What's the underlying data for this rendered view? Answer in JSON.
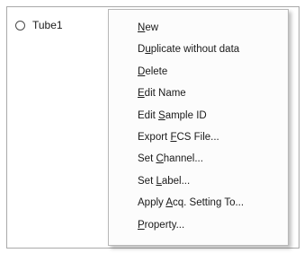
{
  "tree": {
    "item_label": "Tube1",
    "item_icon": "radio-circle-icon"
  },
  "context_menu": {
    "items": [
      {
        "pre": "",
        "mn": "N",
        "post": "ew"
      },
      {
        "pre": "D",
        "mn": "u",
        "post": "plicate without data"
      },
      {
        "pre": "",
        "mn": "D",
        "post": "elete"
      },
      {
        "pre": "",
        "mn": "E",
        "post": "dit Name"
      },
      {
        "pre": "Edit ",
        "mn": "S",
        "post": "ample ID"
      },
      {
        "pre": "Export ",
        "mn": "F",
        "post": "CS File..."
      },
      {
        "pre": "Set ",
        "mn": "C",
        "post": "hannel..."
      },
      {
        "pre": "Set ",
        "mn": "L",
        "post": "abel..."
      },
      {
        "pre": "Apply ",
        "mn": "A",
        "post": "cq. Setting To..."
      },
      {
        "pre": "",
        "mn": "P",
        "post": "roperty..."
      }
    ]
  }
}
